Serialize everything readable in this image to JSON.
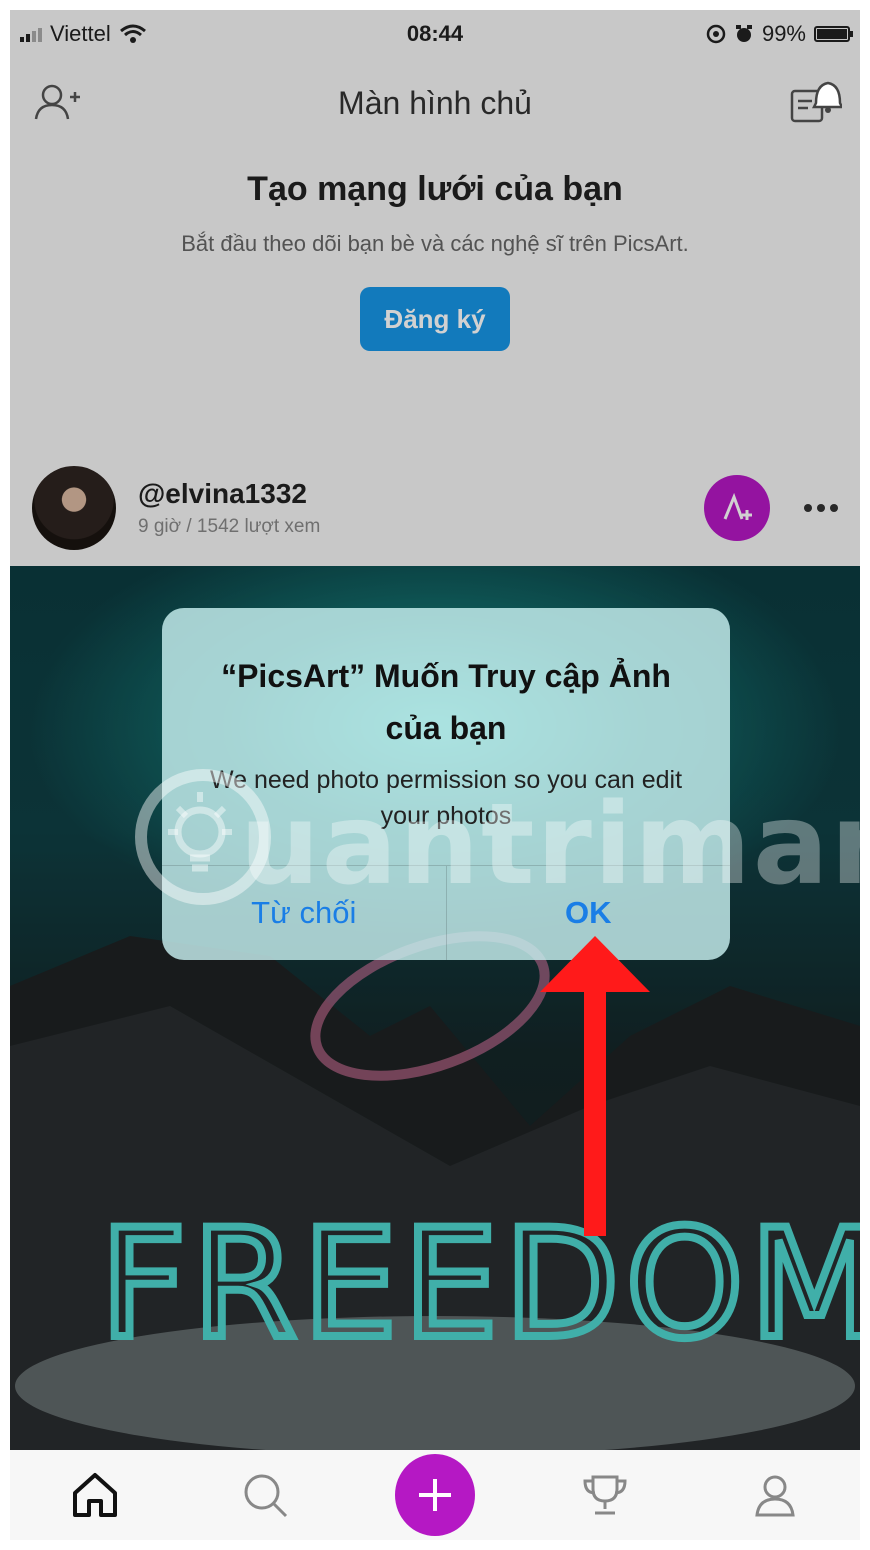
{
  "status_bar": {
    "carrier": "Viettel",
    "time": "08:44",
    "battery": "99%",
    "battery_level": 0.99
  },
  "nav": {
    "title": "Màn hình chủ",
    "left_icon": "add-user-icon",
    "right_icon": "notification-icon"
  },
  "network": {
    "title": "Tạo mạng lưới của bạn",
    "subtitle": "Bắt đầu theo dõi bạn bè và các nghệ sĩ trên PicsArt.",
    "button_label": "Đăng ký"
  },
  "post": {
    "username": "@elvina1332",
    "meta": "9 giờ / 1542 lượt xem",
    "image_text": "FREEDOM"
  },
  "alert": {
    "title": "“PicsArt” Muốn Truy cập Ảnh của bạn",
    "message": "We need photo permission so you can edit your photos",
    "deny_label": "Từ chối",
    "ok_label": "OK"
  },
  "watermark": "uantrimang",
  "tab_bar": {
    "items": [
      "home-icon",
      "search-icon",
      "create-icon",
      "trophy-icon",
      "profile-icon"
    ]
  },
  "colors": {
    "accent_blue": "#1795e6",
    "accent_purple": "#b518c4",
    "alert_button": "#1a7ee6",
    "arrow": "#ff1a1a"
  }
}
